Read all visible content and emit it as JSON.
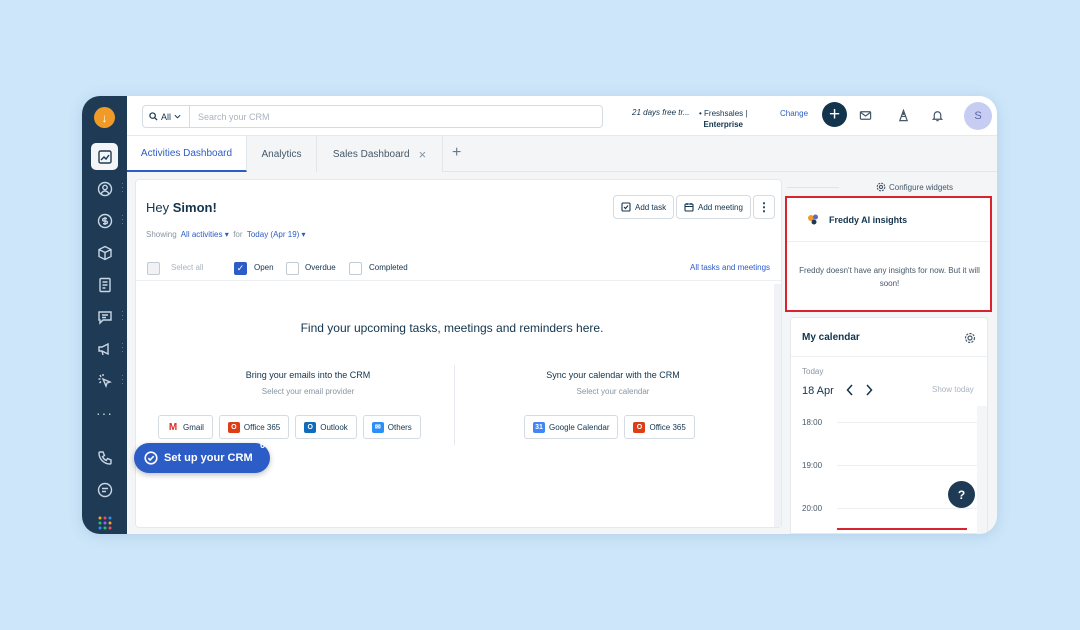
{
  "sidebar": {
    "logo": "↓",
    "items": [
      "dashboard-icon",
      "contacts-icon",
      "deals-icon",
      "products-icon",
      "documents-icon",
      "conversations-icon",
      "campaigns-icon",
      "workflows-icon",
      "more-icon",
      "phone-icon",
      "chat-icon",
      "apps-icon"
    ]
  },
  "topbar": {
    "search_scope": "All",
    "search_placeholder": "Search your CRM",
    "trial_text": "21 days free tr...",
    "plan_line1": "• Freshsales |",
    "plan_line2": "Enterprise",
    "change_label": "Change",
    "plus_label": "+",
    "avatar_initial": "S"
  },
  "tabs": [
    {
      "label": "Activities Dashboard"
    },
    {
      "label": "Analytics"
    },
    {
      "label": "Sales Dashboard",
      "close": "×"
    }
  ],
  "tab_add": "+",
  "main": {
    "greeting_prefix": "Hey",
    "greeting_name": "Simon!",
    "showing_label": "Showing",
    "showing_value": "All activities ▾",
    "for_label": "for",
    "for_value": "Today (Apr 19) ▾",
    "add_task": "Add task",
    "add_meeting": "Add meeting",
    "kebab": "⋮",
    "filters": {
      "select_all": "Select all",
      "open": "Open",
      "overdue": "Overdue",
      "completed": "Completed",
      "all_tasks_link": "All tasks and meetings"
    },
    "empty_title": "Find your upcoming tasks, meetings and reminders here.",
    "email_col": {
      "title": "Bring your emails into the CRM",
      "subtitle": "Select your email provider",
      "providers": [
        "Gmail",
        "Office 365",
        "Outlook",
        "Others"
      ]
    },
    "calendar_col": {
      "title": "Sync your calendar with the CRM",
      "subtitle": "Select your calendar",
      "providers": [
        "Google Calendar",
        "Office 365"
      ]
    }
  },
  "setup": {
    "label": "Set up your CRM",
    "badge": "6"
  },
  "right": {
    "configure_widgets": "Configure widgets",
    "freddy_title": "Freddy AI insights",
    "freddy_message": "Freddy doesn't have any insights for now. But it will soon!",
    "calendar_title": "My calendar",
    "today_label": "Today",
    "date_label": "18 Apr",
    "show_today": "Show today",
    "hours": [
      "18:00",
      "19:00",
      "20:00"
    ]
  },
  "help_label": "?",
  "colors": {
    "accent": "#2c5cc5",
    "sidebar": "#1e3a55",
    "highlight": "#d9232e",
    "brand": "#f09b28"
  }
}
